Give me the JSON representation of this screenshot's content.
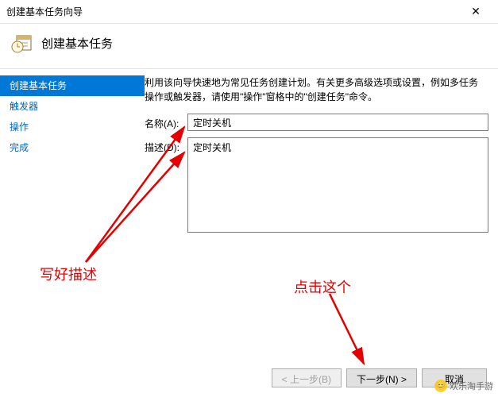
{
  "window": {
    "title": "创建基本任务向导"
  },
  "header": {
    "title": "创建基本任务"
  },
  "sidebar": {
    "items": [
      {
        "label": "创建基本任务"
      },
      {
        "label": "触发器"
      },
      {
        "label": "操作"
      },
      {
        "label": "完成"
      }
    ]
  },
  "main": {
    "desc": "利用该向导快速地为常见任务创建计划。有关更多高级选项或设置，例如多任务操作或触发器，请使用\"操作\"窗格中的\"创建任务\"命令。",
    "name_label": "名称(A):",
    "name_value": "定时关机",
    "desc_label": "描述(D):",
    "desc_value": "定时关机"
  },
  "footer": {
    "back": "< 上一步(B)",
    "next": "下一步(N) >",
    "cancel": "取消"
  },
  "annotations": {
    "left": "写好描述",
    "right": "点击这个"
  },
  "watermark": {
    "text": "欢乐淘手游"
  }
}
